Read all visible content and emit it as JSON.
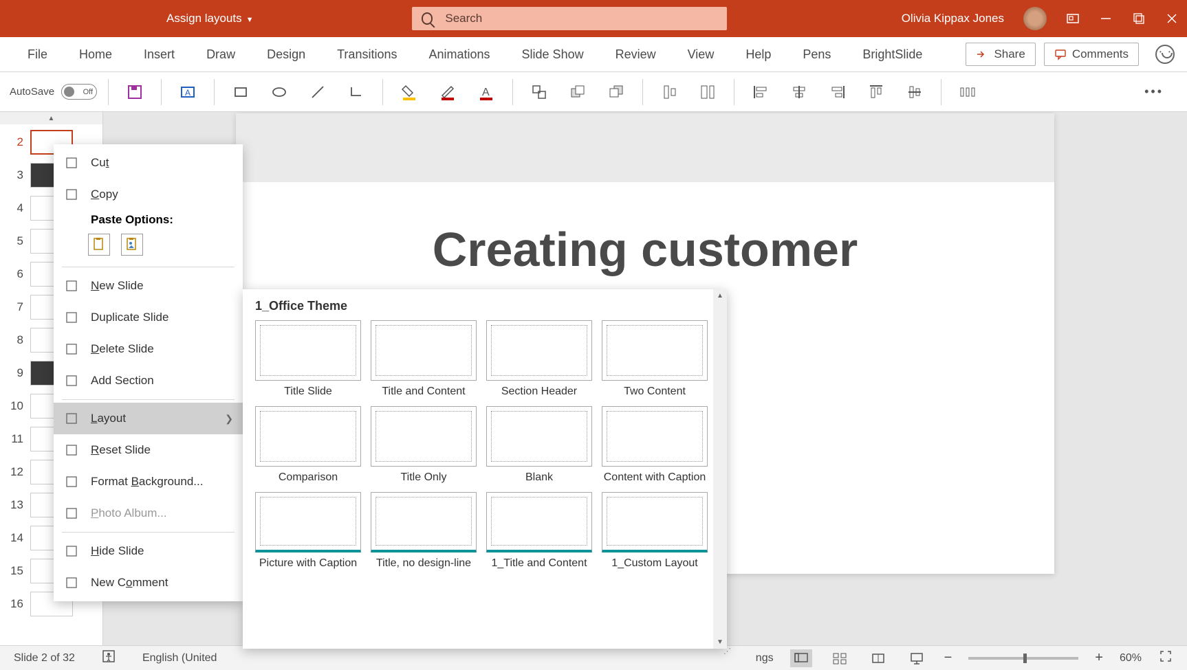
{
  "titlebar": {
    "assign_layouts": "Assign layouts",
    "search_placeholder": "Search",
    "user_name": "Olivia Kippax Jones"
  },
  "ribbon": {
    "tabs": [
      "File",
      "Home",
      "Insert",
      "Draw",
      "Design",
      "Transitions",
      "Animations",
      "Slide Show",
      "Review",
      "View",
      "Help",
      "Pens",
      "BrightSlide"
    ],
    "share": "Share",
    "comments": "Comments"
  },
  "toolbar": {
    "autosave_label": "AutoSave",
    "toggle_state": "Off"
  },
  "thumbnails": {
    "start": 2,
    "end": 16,
    "selected": 2,
    "dark": [
      3,
      9
    ]
  },
  "slide": {
    "title": "Creating customer"
  },
  "context_menu": [
    {
      "icon": "cut-icon",
      "label": "Cut",
      "underline": 2
    },
    {
      "icon": "copy-icon",
      "label": "Copy",
      "underline": 0
    },
    {
      "header": "Paste Options:"
    },
    {
      "paste_options": true
    },
    {
      "sep": true
    },
    {
      "icon": "new-slide-icon",
      "label": "New Slide",
      "underline": 0
    },
    {
      "icon": "duplicate-icon",
      "label": "Duplicate Slide"
    },
    {
      "icon": "delete-icon",
      "label": "Delete Slide",
      "underline": 0
    },
    {
      "icon": "section-icon",
      "label": "Add Section"
    },
    {
      "sep": true
    },
    {
      "icon": "layout-icon",
      "label": "Layout",
      "underline": 0,
      "arrow": true,
      "hover": true
    },
    {
      "icon": "reset-icon",
      "label": "Reset Slide",
      "underline": 0
    },
    {
      "icon": "format-bg-icon",
      "label": "Format Background...",
      "underline": 7
    },
    {
      "icon": "photo-icon",
      "label": "Photo Album...",
      "underline": 0,
      "disabled": true
    },
    {
      "sep": true
    },
    {
      "icon": "hide-icon",
      "label": "Hide Slide",
      "underline": 0
    },
    {
      "icon": "comment-icon",
      "label": "New Comment",
      "underline": 5
    }
  ],
  "layout_flyout": {
    "theme": "1_Office Theme",
    "layouts": [
      "Title Slide",
      "Title and Content",
      "Section Header",
      "Two Content",
      "Comparison",
      "Title Only",
      "Blank",
      "Content with Caption",
      "Picture with Caption",
      "Title, no design-line",
      "1_Title and Content",
      "1_Custom Layout"
    ]
  },
  "statusbar": {
    "slide_info": "Slide 2 of 32",
    "language_partial": "English (United",
    "notes_partial": "ngs",
    "zoom": "60%"
  }
}
